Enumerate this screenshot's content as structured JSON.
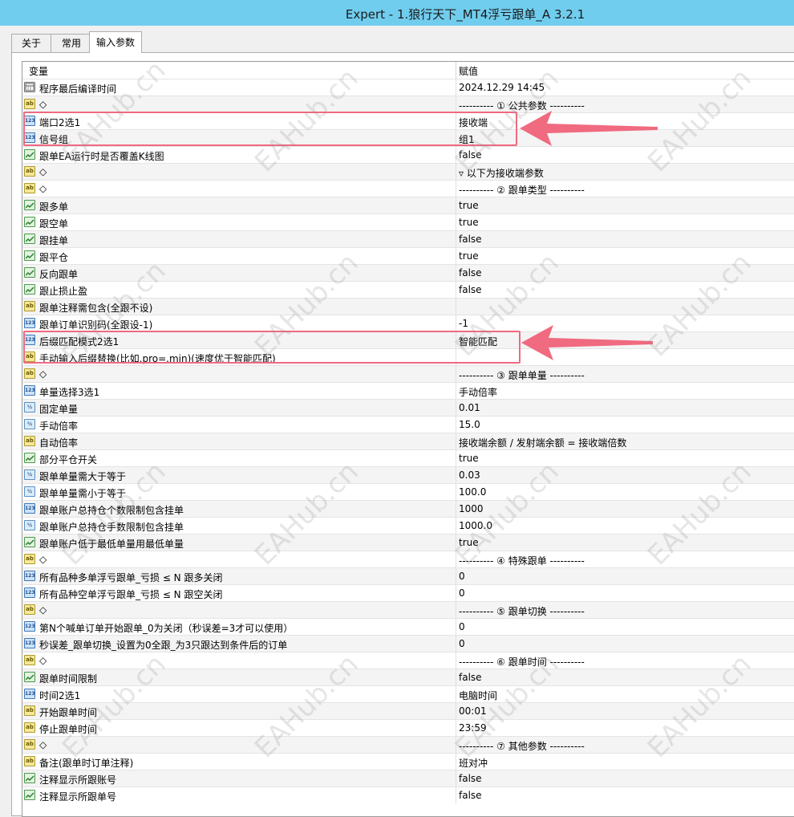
{
  "window": {
    "title": "Expert - 1.狼行天下_MT4浮亏跟单_A 3.2.1"
  },
  "tabs": [
    {
      "label": "关于"
    },
    {
      "label": "常用"
    },
    {
      "label": "输入参数"
    }
  ],
  "grid": {
    "col_variable": "变量",
    "col_value": "赋值",
    "rows": [
      {
        "icon": "datetime-icon",
        "type": "dt",
        "name": "程序最后编译时间",
        "value": "2024.12.29 14:45"
      },
      {
        "icon": "string-icon",
        "type": "ab",
        "name": "◇",
        "value": "---------- ① 公共参数 ----------"
      },
      {
        "icon": "integer-icon",
        "type": "n123",
        "name": "端口2选1",
        "value": "接收端"
      },
      {
        "icon": "integer-icon",
        "type": "n123",
        "name": "信号组",
        "value": "组1"
      },
      {
        "icon": "bool-icon",
        "type": "bool",
        "name": "跟单EA运行时是否覆盖K线图",
        "value": "false"
      },
      {
        "icon": "string-icon",
        "type": "ab",
        "name": "◇",
        "value": "▿ 以下为接收端参数"
      },
      {
        "icon": "string-icon",
        "type": "ab",
        "name": "◇",
        "value": "---------- ② 跟单类型 ----------"
      },
      {
        "icon": "bool-icon",
        "type": "bool",
        "name": "跟多单",
        "value": "true"
      },
      {
        "icon": "bool-icon",
        "type": "bool",
        "name": "跟空单",
        "value": "true"
      },
      {
        "icon": "bool-icon",
        "type": "bool",
        "name": "跟挂单",
        "value": "false"
      },
      {
        "icon": "bool-icon",
        "type": "bool",
        "name": "跟平仓",
        "value": "true"
      },
      {
        "icon": "bool-icon",
        "type": "bool",
        "name": "反向跟单",
        "value": "false"
      },
      {
        "icon": "bool-icon",
        "type": "bool",
        "name": "跟止损止盈",
        "value": "false"
      },
      {
        "icon": "string-icon",
        "type": "ab",
        "name": "跟单注释需包含(全跟不设)",
        "value": ""
      },
      {
        "icon": "integer-icon",
        "type": "n123",
        "name": "跟单订单识别码(全跟设-1)",
        "value": "-1"
      },
      {
        "icon": "integer-icon",
        "type": "n123",
        "name": "后缀匹配模式2选1",
        "value": "智能匹配"
      },
      {
        "icon": "string-icon",
        "type": "ab",
        "name": "手动输入后缀替换(比如.pro=.min)(速度优于智能匹配)",
        "value": ""
      },
      {
        "icon": "string-icon",
        "type": "ab",
        "name": "◇",
        "value": "---------- ③ 跟单单量 ----------"
      },
      {
        "icon": "integer-icon",
        "type": "n123",
        "name": "单量选择3选1",
        "value": "手动倍率"
      },
      {
        "icon": "double-icon",
        "type": "half",
        "name": "固定单量",
        "value": "0.01"
      },
      {
        "icon": "double-icon",
        "type": "half",
        "name": "手动倍率",
        "value": "15.0"
      },
      {
        "icon": "string-icon",
        "type": "ab",
        "name": "自动倍率",
        "value": "接收端余额 / 发射端余额 = 接收端倍数"
      },
      {
        "icon": "bool-icon",
        "type": "bool",
        "name": "部分平仓开关",
        "value": "true"
      },
      {
        "icon": "double-icon",
        "type": "half",
        "name": "跟单单量需大于等于",
        "value": "0.03"
      },
      {
        "icon": "double-icon",
        "type": "half",
        "name": "跟单单量需小于等于",
        "value": "100.0"
      },
      {
        "icon": "integer-icon",
        "type": "n123",
        "name": "跟单账户总持仓个数限制包含挂单",
        "value": "1000"
      },
      {
        "icon": "double-icon",
        "type": "half",
        "name": "跟单账户总持仓手数限制包含挂单",
        "value": "1000.0"
      },
      {
        "icon": "bool-icon",
        "type": "bool",
        "name": "跟单账户低于最低单量用最低单量",
        "value": "true"
      },
      {
        "icon": "string-icon",
        "type": "ab",
        "name": "◇",
        "value": "---------- ④ 特殊跟单 ----------"
      },
      {
        "icon": "integer-icon",
        "type": "n123",
        "name": "所有品种多单浮亏跟单_亏损 ≤ N 跟多关闭",
        "value": "0"
      },
      {
        "icon": "integer-icon",
        "type": "n123",
        "name": "所有品种空单浮亏跟单_亏损 ≤ N 跟空关闭",
        "value": "0"
      },
      {
        "icon": "string-icon",
        "type": "ab",
        "name": "◇",
        "value": "---------- ⑤ 跟单切换 ----------"
      },
      {
        "icon": "integer-icon",
        "type": "n123",
        "name": "第N个喊单订单开始跟单_0为关闭（秒误差=3才可以使用）",
        "value": "0"
      },
      {
        "icon": "integer-icon",
        "type": "n123",
        "name": "秒误差_跟单切换_设置为0全跟_为3只跟达到条件后的订单",
        "value": "0"
      },
      {
        "icon": "string-icon",
        "type": "ab",
        "name": "◇",
        "value": "---------- ⑥ 跟单时间 ----------"
      },
      {
        "icon": "bool-icon",
        "type": "bool",
        "name": "跟单时间限制",
        "value": "false"
      },
      {
        "icon": "integer-icon",
        "type": "n123",
        "name": "时间2选1",
        "value": "电脑时间"
      },
      {
        "icon": "string-icon",
        "type": "ab",
        "name": "开始跟单时间",
        "value": "00:01"
      },
      {
        "icon": "string-icon",
        "type": "ab",
        "name": "停止跟单时间",
        "value": "23:59"
      },
      {
        "icon": "string-icon",
        "type": "ab",
        "name": "◇",
        "value": "---------- ⑦ 其他参数 ----------"
      },
      {
        "icon": "string-icon",
        "type": "ab",
        "name": "备注(跟单时订单注释)",
        "value": "班对冲"
      },
      {
        "icon": "bool-icon",
        "type": "bool",
        "name": "注释显示所跟账号",
        "value": "false"
      },
      {
        "icon": "bool-icon",
        "type": "bool",
        "name": "注释显示所跟单号",
        "value": "false"
      }
    ]
  },
  "icon_glyphs": {
    "ab": "ab",
    "n123": "123",
    "half": "½"
  },
  "watermark": "EAHub.cn",
  "colors": {
    "titlebar": "#71cdee",
    "callout": "#f06a80"
  }
}
